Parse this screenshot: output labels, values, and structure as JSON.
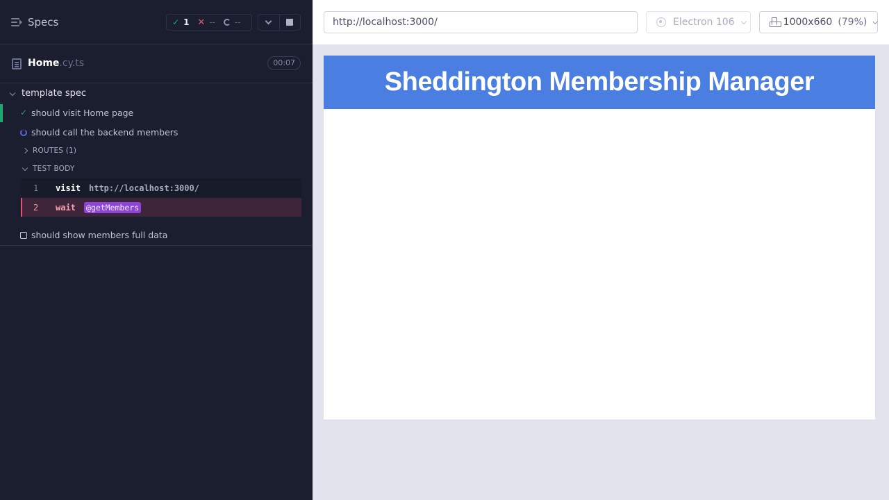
{
  "reporter": {
    "specs_label": "Specs",
    "stats": {
      "passed": "1",
      "failed": "--",
      "pending": "--"
    },
    "spec_file": {
      "base": "Home",
      "ext": ".cy.ts",
      "duration": "00:07"
    },
    "suite": {
      "title": "template spec"
    },
    "tests": [
      {
        "title": "should visit Home page",
        "state": "passed"
      },
      {
        "title": "should call the backend members",
        "state": "running"
      },
      {
        "title": "should show members full data",
        "state": "pending"
      }
    ],
    "routes_label": "ROUTES (1)",
    "test_body_label": "TEST BODY",
    "commands": [
      {
        "number": "1",
        "name": "visit",
        "message": "http://localhost:3000/"
      },
      {
        "number": "2",
        "name": "wait",
        "alias": "@getMembers"
      }
    ]
  },
  "aut": {
    "url": "http://localhost:3000/",
    "browser": "Electron 106",
    "viewport": "1000x660",
    "scale": "(79%)",
    "app_title": "Sheddington Membership Manager"
  },
  "colors": {
    "reporter_bg": "#1b1e2e",
    "passed": "#1fa971",
    "failed": "#e45770",
    "running": "#5b6ad8",
    "alias": "#8c45d8",
    "app_header": "#4a7ee0"
  }
}
